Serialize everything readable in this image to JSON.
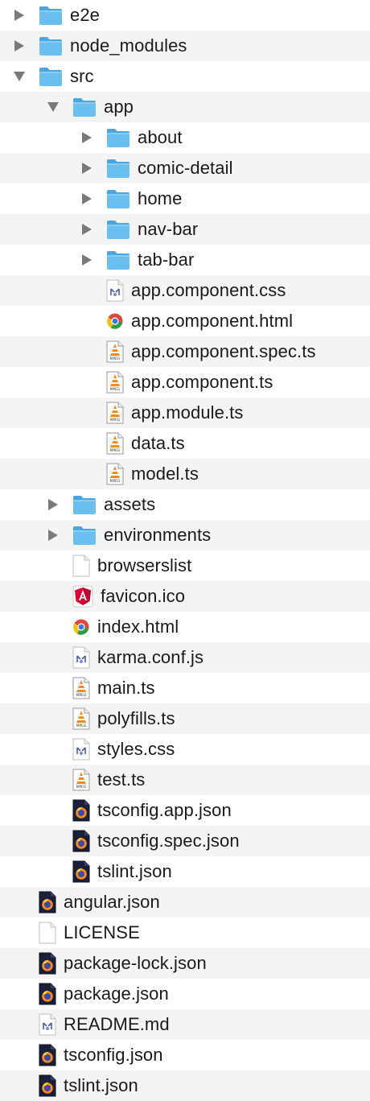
{
  "tree": {
    "items": [
      {
        "label": "e2e",
        "depth": 0,
        "kind": "folder",
        "expanded": false,
        "icon": "folder-icon"
      },
      {
        "label": "node_modules",
        "depth": 0,
        "kind": "folder",
        "expanded": false,
        "icon": "folder-icon"
      },
      {
        "label": "src",
        "depth": 0,
        "kind": "folder",
        "expanded": true,
        "icon": "folder-icon"
      },
      {
        "label": "app",
        "depth": 1,
        "kind": "folder",
        "expanded": true,
        "icon": "folder-icon"
      },
      {
        "label": "about",
        "depth": 2,
        "kind": "folder",
        "expanded": false,
        "icon": "folder-icon"
      },
      {
        "label": "comic-detail",
        "depth": 2,
        "kind": "folder",
        "expanded": false,
        "icon": "folder-icon"
      },
      {
        "label": "home",
        "depth": 2,
        "kind": "folder",
        "expanded": false,
        "icon": "folder-icon"
      },
      {
        "label": "nav-bar",
        "depth": 2,
        "kind": "folder",
        "expanded": false,
        "icon": "folder-icon"
      },
      {
        "label": "tab-bar",
        "depth": 2,
        "kind": "folder",
        "expanded": false,
        "icon": "folder-icon"
      },
      {
        "label": "app.component.css",
        "depth": 2,
        "kind": "file",
        "icon": "css-file-icon"
      },
      {
        "label": "app.component.html",
        "depth": 2,
        "kind": "file",
        "icon": "chrome-html-file-icon"
      },
      {
        "label": "app.component.spec.ts",
        "depth": 2,
        "kind": "file",
        "icon": "mpeg-file-icon"
      },
      {
        "label": "app.component.ts",
        "depth": 2,
        "kind": "file",
        "icon": "mpeg-file-icon"
      },
      {
        "label": "app.module.ts",
        "depth": 2,
        "kind": "file",
        "icon": "mpeg-file-icon"
      },
      {
        "label": "data.ts",
        "depth": 2,
        "kind": "file",
        "icon": "mpeg-file-icon"
      },
      {
        "label": "model.ts",
        "depth": 2,
        "kind": "file",
        "icon": "mpeg-file-icon"
      },
      {
        "label": "assets",
        "depth": 1,
        "kind": "folder",
        "expanded": false,
        "icon": "folder-icon"
      },
      {
        "label": "environments",
        "depth": 1,
        "kind": "folder",
        "expanded": false,
        "icon": "folder-icon"
      },
      {
        "label": "browserslist",
        "depth": 1,
        "kind": "file",
        "icon": "blank-file-icon"
      },
      {
        "label": "favicon.ico",
        "depth": 1,
        "kind": "file",
        "icon": "angular-file-icon"
      },
      {
        "label": "index.html",
        "depth": 1,
        "kind": "file",
        "icon": "chrome-html-file-icon"
      },
      {
        "label": "karma.conf.js",
        "depth": 1,
        "kind": "file",
        "icon": "css-file-icon"
      },
      {
        "label": "main.ts",
        "depth": 1,
        "kind": "file",
        "icon": "mpeg-file-icon"
      },
      {
        "label": "polyfills.ts",
        "depth": 1,
        "kind": "file",
        "icon": "mpeg-file-icon"
      },
      {
        "label": "styles.css",
        "depth": 1,
        "kind": "file",
        "icon": "css-file-icon"
      },
      {
        "label": "test.ts",
        "depth": 1,
        "kind": "file",
        "icon": "mpeg-file-icon"
      },
      {
        "label": "tsconfig.app.json",
        "depth": 1,
        "kind": "file",
        "icon": "firefox-file-icon"
      },
      {
        "label": "tsconfig.spec.json",
        "depth": 1,
        "kind": "file",
        "icon": "firefox-file-icon"
      },
      {
        "label": "tslint.json",
        "depth": 1,
        "kind": "file",
        "icon": "firefox-file-icon"
      },
      {
        "label": "angular.json",
        "depth": 0,
        "kind": "file",
        "icon": "firefox-file-icon"
      },
      {
        "label": "LICENSE",
        "depth": 0,
        "kind": "file",
        "icon": "blank-file-icon"
      },
      {
        "label": "package-lock.json",
        "depth": 0,
        "kind": "file",
        "icon": "firefox-file-icon"
      },
      {
        "label": "package.json",
        "depth": 0,
        "kind": "file",
        "icon": "firefox-file-icon"
      },
      {
        "label": "README.md",
        "depth": 0,
        "kind": "file",
        "icon": "css-file-icon"
      },
      {
        "label": "tsconfig.json",
        "depth": 0,
        "kind": "file",
        "icon": "firefox-file-icon"
      },
      {
        "label": "tslint.json",
        "depth": 0,
        "kind": "file",
        "icon": "firefox-file-icon"
      }
    ]
  },
  "colors": {
    "folder_body": "#69bff0",
    "folder_tab": "#4aa6df",
    "stripe": "#f4f4f5",
    "text": "#1a1a1a",
    "disclosure": "#7a7a7a"
  }
}
